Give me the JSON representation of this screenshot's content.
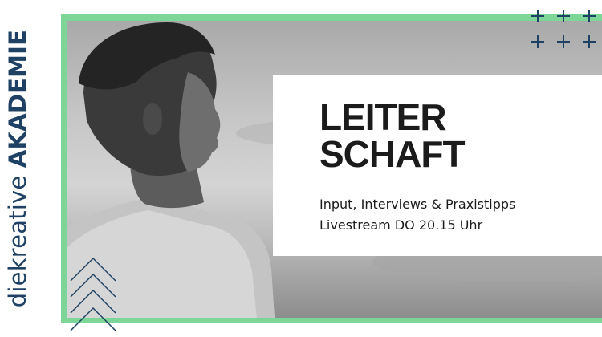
{
  "brand": {
    "prefix": "diekreative ",
    "name": "AKADEMIE",
    "color": "#1f4163",
    "frame_color": "#7dd598"
  },
  "headline": {
    "line1": "LEITER",
    "line2": "SCHAFT"
  },
  "details": {
    "line1": "Input, Interviews & Praxistipps",
    "line2": "Livestream DO 20.15 Uhr"
  },
  "decorations": {
    "plus_icon": "plus-icon",
    "chevron_icon": "chevron-up-icon"
  }
}
